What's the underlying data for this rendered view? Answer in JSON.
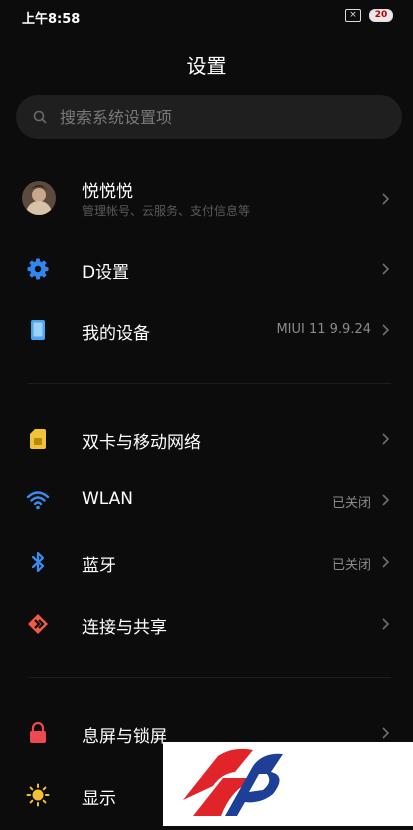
{
  "status_bar": {
    "time": "上午8:58",
    "battery": "20"
  },
  "header": {
    "title": "设置"
  },
  "search": {
    "placeholder": "搜索系统设置项"
  },
  "account": {
    "name": "悦悦悦",
    "subtitle": "管理帐号、云服务、支付信息等"
  },
  "items": [
    {
      "label": "D设置",
      "value": "",
      "icon": "gear-icon"
    },
    {
      "label": "我的设备",
      "value": "MIUI 11 9.9.24",
      "icon": "device-icon"
    },
    {
      "label": "双卡与移动网络",
      "value": "",
      "icon": "sim-card-icon"
    },
    {
      "label": "WLAN",
      "value": "已关闭",
      "icon": "wifi-icon"
    },
    {
      "label": "蓝牙",
      "value": "已关闭",
      "icon": "bluetooth-icon"
    },
    {
      "label": "连接与共享",
      "value": "",
      "icon": "connection-share-icon"
    },
    {
      "label": "息屏与锁屏",
      "value": "",
      "icon": "lock-icon"
    },
    {
      "label": "显示",
      "value": "",
      "icon": "brightness-icon"
    }
  ],
  "colors": {
    "background": "#0c0c0c",
    "gear": "#2f86ef",
    "device": "#4aa6f0",
    "sim": "#f1c33b",
    "wifi": "#3b8bf0",
    "bluetooth": "#3b8bf0",
    "share": "#ee5c45",
    "lock": "#ec4a4e",
    "brightness": "#f3c233",
    "logo_red": "#e1232a",
    "logo_blue": "#1d3f95"
  }
}
